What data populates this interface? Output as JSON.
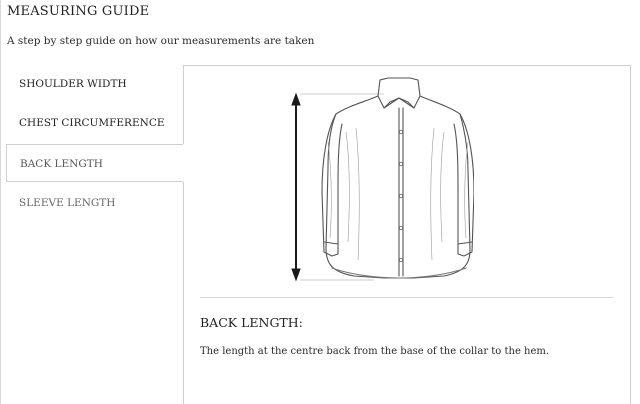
{
  "header": {
    "title": "MEASURING GUIDE",
    "subtitle": "A step by step guide on how our measurements are taken"
  },
  "tabs": [
    {
      "label": "SHOULDER WIDTH",
      "active": false
    },
    {
      "label": "CHEST CIRCUMFERENCE",
      "active": false
    },
    {
      "label": "BACK LENGTH",
      "active": true
    },
    {
      "label": "SLEEVE LENGTH",
      "active": false
    }
  ],
  "detail": {
    "title": "BACK LENGTH:",
    "description": "The length at the centre back from the base of the collar to the hem.",
    "illustration": "shirt-back-length-illustration"
  },
  "colors": {
    "text": "#222222",
    "border": "#cfcfcf",
    "divider": "#d8d8d8",
    "background": "#ffffff"
  }
}
